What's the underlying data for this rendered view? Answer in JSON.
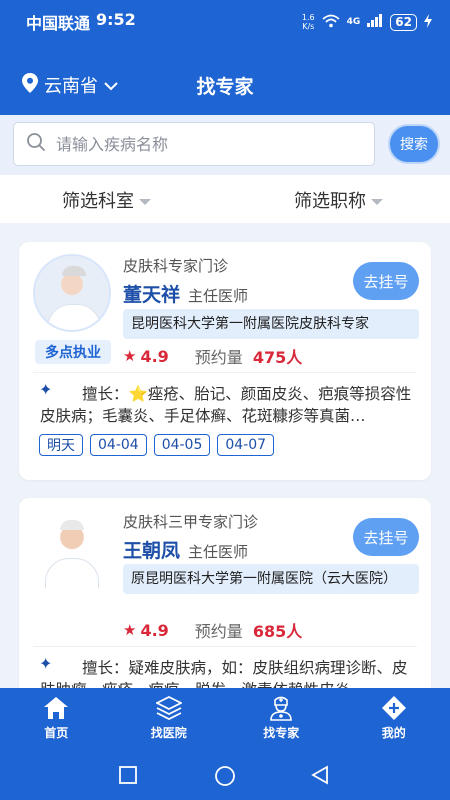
{
  "status_bar": {
    "carrier": "中国联通",
    "time": "9:52",
    "net_speed_top": "1.6",
    "net_speed_bottom": "K/s",
    "network": "4G",
    "battery": "62"
  },
  "header": {
    "location": "云南省",
    "title": "找专家"
  },
  "search": {
    "placeholder": "请输入疾病名称",
    "button": "搜索"
  },
  "filters": {
    "department": "筛选科室",
    "title": "筛选职称"
  },
  "doctors": [
    {
      "clinic": "皮肤科专家门诊",
      "name": "董天祥",
      "title": "主任医师",
      "book": "去挂号",
      "tag": "多点执业",
      "hospital": "昆明医科大学第一附属医院皮肤科专家",
      "rating": "4.9",
      "appt_label": "预约量",
      "appt_count": "475人",
      "specialty": "擅长：⭐痤疮、胎记、颜面皮炎、疤痕等损容性皮肤病；毛囊炎、手足体癣、花斑糠疹等真菌…",
      "dates": [
        "明天",
        "04-04",
        "04-05",
        "04-07"
      ]
    },
    {
      "clinic": "皮肤科三甲专家门诊",
      "name": "王朝凤",
      "title": "主任医师",
      "book": "去挂号",
      "hospital": "原昆明医科大学第一附属医院（云大医院）",
      "rating": "4.9",
      "appt_label": "预约量",
      "appt_count": "685人",
      "specialty": "擅长：疑难皮肤病，如：皮肤组织病理诊断、皮肤肿瘤、痤疮、疤痕、脱发、激素依赖性皮炎"
    }
  ],
  "bottom_nav": [
    {
      "label": "首页",
      "icon": "home-icon"
    },
    {
      "label": "找医院",
      "icon": "layers-icon"
    },
    {
      "label": "找专家",
      "icon": "doctor-icon"
    },
    {
      "label": "我的",
      "icon": "diamond-plus-icon"
    }
  ],
  "colors": {
    "primary": "#1e64d2",
    "accent": "#d8283a",
    "button": "#5fa0f3"
  }
}
